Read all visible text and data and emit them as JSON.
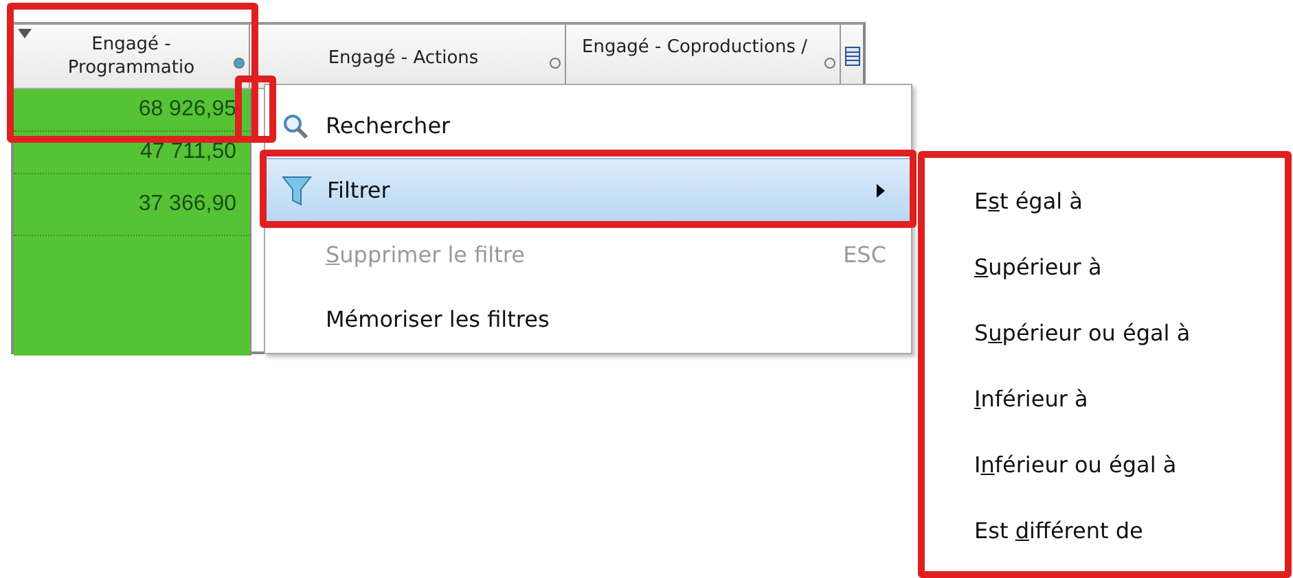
{
  "grid": {
    "columns": [
      {
        "label": "Engagé - Programmatio",
        "sorted": true
      },
      {
        "label": "Engagé - Actions",
        "sorted": false
      },
      {
        "label": "Engagé - Coproductions /",
        "sorted": false
      }
    ],
    "rows": [
      "68 926,95",
      "47 711,50",
      "37 366,90"
    ]
  },
  "context_menu": {
    "items": [
      {
        "kind": "search",
        "after": "Rechercher",
        "disabled": false,
        "selected": false,
        "submenu": false
      },
      {
        "kind": "filter",
        "after": "Filtrer",
        "disabled": false,
        "selected": true,
        "submenu": true
      },
      {
        "kind": "plain",
        "key": "S",
        "after": "upprimer le filtre",
        "shortcut": "ESC",
        "disabled": true,
        "selected": false,
        "submenu": false
      },
      {
        "kind": "plain",
        "after": "Mémoriser les filtres",
        "disabled": false,
        "selected": false,
        "submenu": false
      }
    ]
  },
  "submenu": {
    "items": [
      {
        "before": "E",
        "key": "s",
        "after": "t égal à"
      },
      {
        "key": "S",
        "after": "upérieur à"
      },
      {
        "before": "S",
        "key": "u",
        "after": "périeur ou égal à"
      },
      {
        "key": "I",
        "after": "nférieur à"
      },
      {
        "before": "I",
        "key": "n",
        "after": "férieur ou égal à"
      },
      {
        "before": "Est ",
        "key": "d",
        "after": "ifférent de"
      }
    ]
  }
}
